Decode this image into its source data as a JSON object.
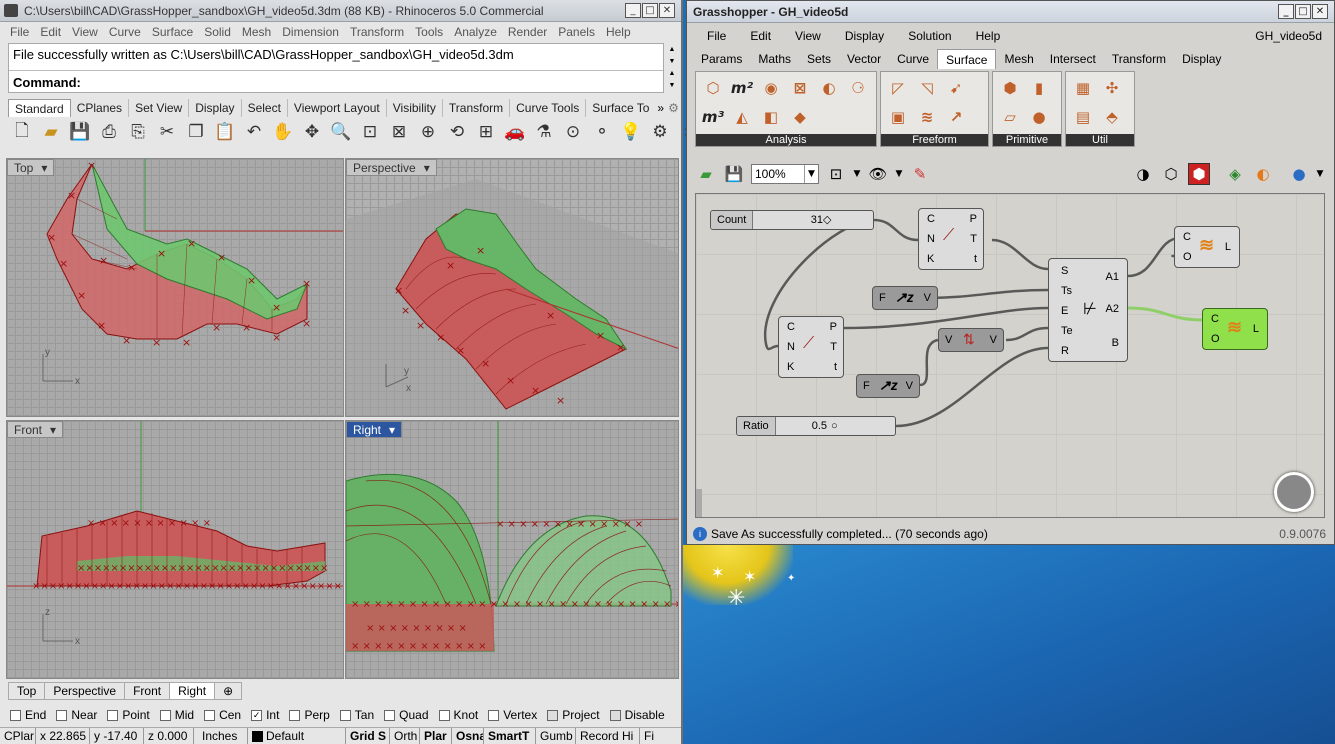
{
  "rhino": {
    "title": "C:\\Users\\bill\\CAD\\GrassHopper_sandbox\\GH_video5d.3dm (88 KB) - Rhinoceros 5.0 Commercial",
    "menu": [
      "File",
      "Edit",
      "View",
      "Curve",
      "Surface",
      "Solid",
      "Mesh",
      "Dimension",
      "Transform",
      "Tools",
      "Analyze",
      "Render",
      "Panels",
      "Help"
    ],
    "cmd_history": "File successfully written as C:\\Users\\bill\\CAD\\GrassHopper_sandbox\\GH_video5d.3dm",
    "cmd_prompt": "Command:",
    "toolbar_tabs": [
      "Standard",
      "CPlanes",
      "Set View",
      "Display",
      "Select",
      "Viewport Layout",
      "Visibility",
      "Transform",
      "Curve Tools",
      "Surface To"
    ],
    "viewports": {
      "top": "Top",
      "perspective": "Perspective",
      "front": "Front",
      "right": "Right"
    },
    "viewport_tabs": [
      "Top",
      "Perspective",
      "Front",
      "Right"
    ],
    "osnaps": [
      {
        "label": "End",
        "checked": false
      },
      {
        "label": "Near",
        "checked": false
      },
      {
        "label": "Point",
        "checked": false
      },
      {
        "label": "Mid",
        "checked": false
      },
      {
        "label": "Cen",
        "checked": false
      },
      {
        "label": "Int",
        "checked": true
      },
      {
        "label": "Perp",
        "checked": false
      },
      {
        "label": "Tan",
        "checked": false
      },
      {
        "label": "Quad",
        "checked": false
      },
      {
        "label": "Knot",
        "checked": false
      },
      {
        "label": "Vertex",
        "checked": false
      },
      {
        "label": "Project",
        "checked": false
      },
      {
        "label": "Disable",
        "checked": false
      }
    ],
    "status": {
      "cplane": "CPlar",
      "x": "x 22.865",
      "y": "y -17.40",
      "z": "z 0.000",
      "units": "Inches",
      "layer": "Default",
      "grid": "Grid S",
      "ortho": "Orth",
      "planar": "Plar",
      "osnap": "Osna",
      "smarttrack": "SmartT",
      "gumball": "Gumb",
      "record": "Record Hi",
      "filter": "Fi"
    }
  },
  "gh": {
    "title": "Grasshopper - GH_video5d",
    "menu": [
      "File",
      "Edit",
      "View",
      "Display",
      "Solution",
      "Help"
    ],
    "doc_name": "GH_video5d",
    "tabs": [
      "Params",
      "Maths",
      "Sets",
      "Vector",
      "Curve",
      "Surface",
      "Mesh",
      "Intersect",
      "Transform",
      "Display"
    ],
    "ribbon_groups": [
      "Analysis",
      "Freeform",
      "Primitive",
      "Util"
    ],
    "zoom": "100%",
    "sliders": {
      "count": {
        "name": "Count",
        "value": "31"
      },
      "ratio": {
        "name": "Ratio",
        "value": "0.5"
      }
    },
    "ports": {
      "div1_in": [
        "C",
        "N",
        "K"
      ],
      "div1_out": [
        "P",
        "T",
        "t"
      ],
      "div2_in": [
        "C",
        "N",
        "K"
      ],
      "div2_out": [
        "P",
        "T",
        "t"
      ],
      "sweep_in": [
        "S",
        "Ts",
        "E",
        "Te",
        "R"
      ],
      "sweep_out": [
        "A1",
        "A2",
        "B"
      ],
      "loft1_in": [
        "C",
        "O"
      ],
      "loft1_out": [
        "L"
      ],
      "loft2_in": [
        "C",
        "O"
      ],
      "loft2_out": [
        "L"
      ],
      "flip1_in": [
        "F"
      ],
      "flip1_out": [
        "V"
      ],
      "flip2_in": [
        "F"
      ],
      "flip2_out": [
        "V"
      ],
      "vec_in": [
        "V"
      ],
      "vec_out": [
        "V"
      ]
    },
    "status_msg": "Save As successfully completed... (70 seconds ago)",
    "version": "0.9.0076"
  }
}
